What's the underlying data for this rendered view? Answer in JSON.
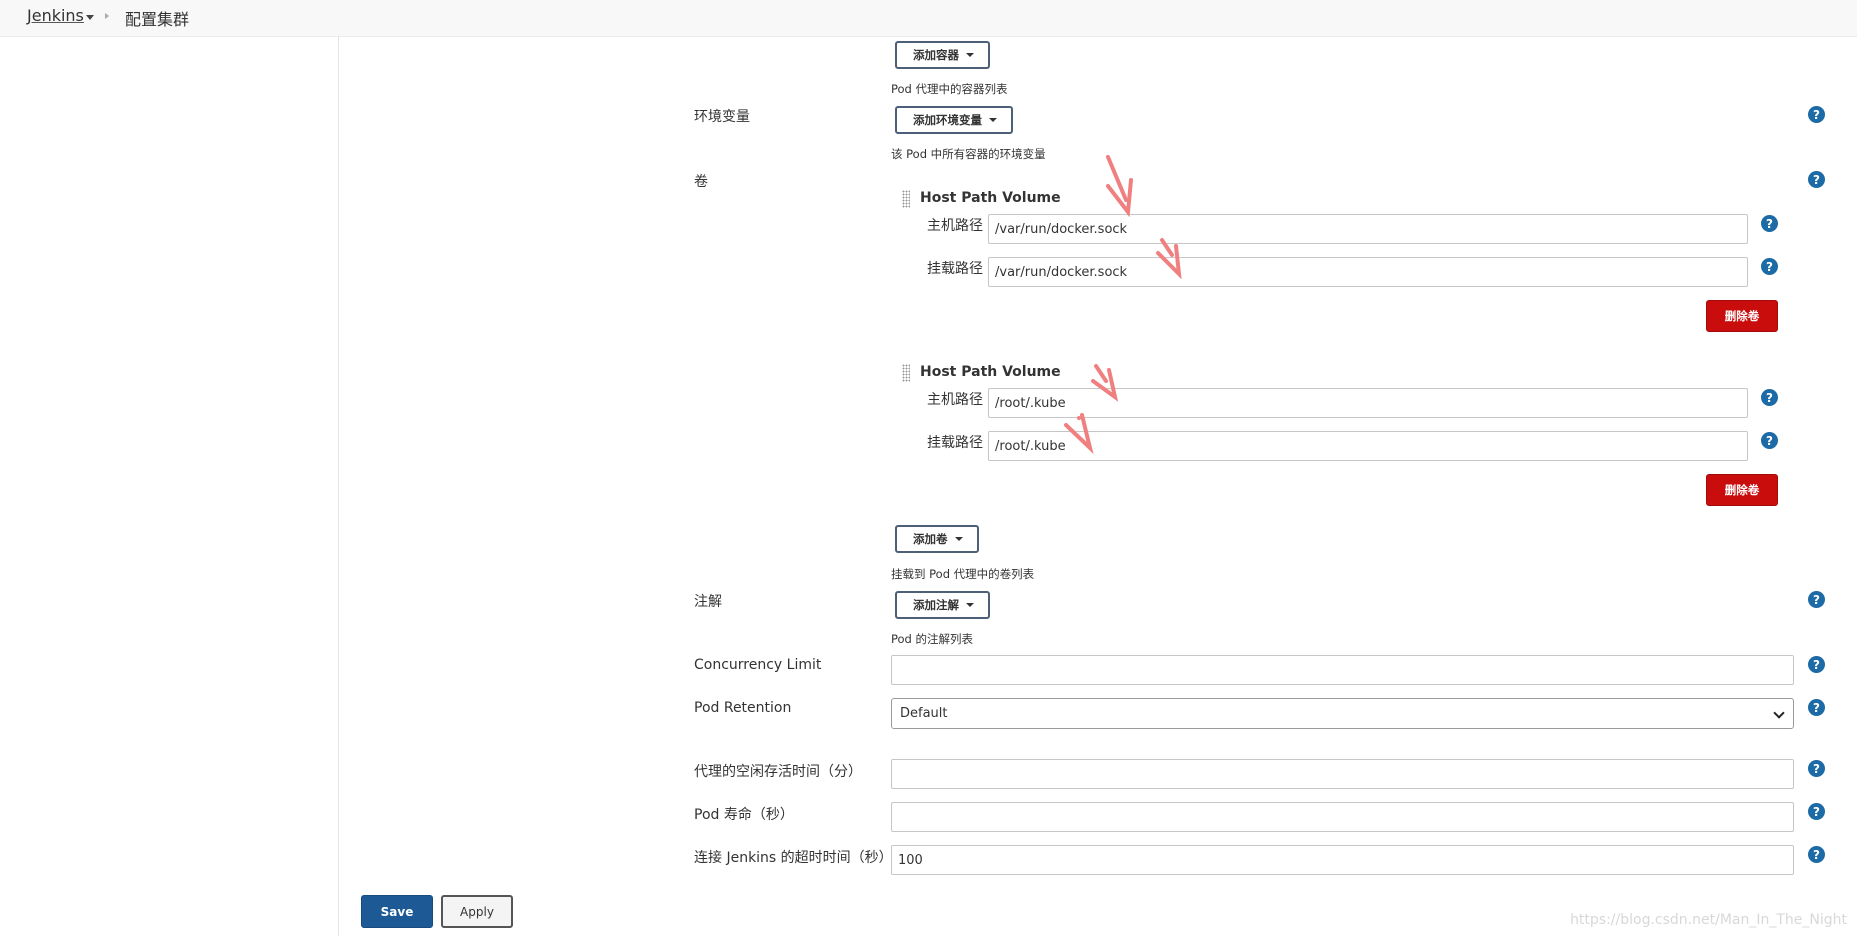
{
  "breadcrumb": {
    "brand": "Jenkins",
    "current": "配置集群"
  },
  "containers": {
    "add_button": "添加容器",
    "description": "Pod 代理中的容器列表"
  },
  "env_vars": {
    "label": "环境变量",
    "add_button": "添加环境变量",
    "description": "该 Pod 中所有容器的环境变量"
  },
  "volumes": {
    "label": "卷",
    "items": [
      {
        "title": "Host Path Volume",
        "host_path_label": "主机路径",
        "host_path": "/var/run/docker.sock",
        "mount_path_label": "挂载路径",
        "mount_path": "/var/run/docker.sock",
        "delete_button": "删除卷"
      },
      {
        "title": "Host Path Volume",
        "host_path_label": "主机路径",
        "host_path": "/root/.kube",
        "mount_path_label": "挂载路径",
        "mount_path": "/root/.kube",
        "delete_button": "删除卷"
      }
    ],
    "add_button": "添加卷",
    "description": "挂载到 Pod 代理中的卷列表"
  },
  "annotations": {
    "label": "注解",
    "add_button": "添加注解",
    "description": "Pod 的注解列表"
  },
  "concurrency_limit": {
    "label": "Concurrency Limit",
    "value": ""
  },
  "pod_retention": {
    "label": "Pod Retention",
    "value": "Default"
  },
  "idle_minutes": {
    "label": "代理的空闲存活时间（分）",
    "value": ""
  },
  "pod_lifetime": {
    "label": "Pod 寿命（秒）",
    "value": ""
  },
  "connect_timeout": {
    "label": "连接 Jenkins 的超时时间（秒）",
    "value": "100"
  },
  "help_symbol": "?",
  "actions": {
    "save": "Save",
    "apply": "Apply"
  },
  "watermark": "https://blog.csdn.net/Man_In_The_Night",
  "colors": {
    "primary": "#1d5a95",
    "danger": "#c90d0d",
    "help": "#1c6aa6",
    "annotation_arrow": "#f08080"
  }
}
